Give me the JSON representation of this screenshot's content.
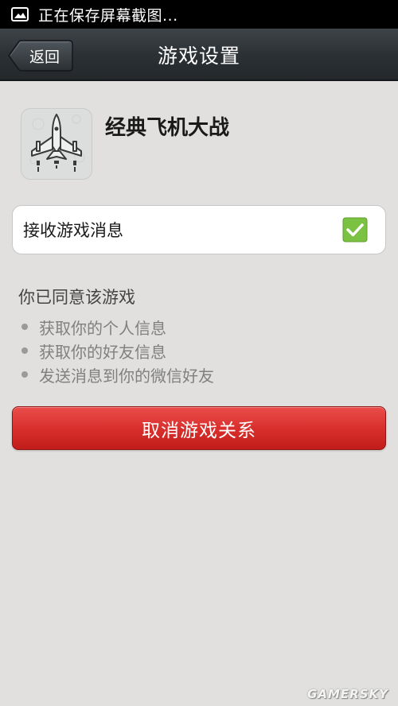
{
  "status_bar": {
    "text": "正在保存屏幕截图...",
    "icon": "screenshot-icon"
  },
  "nav": {
    "back_label": "返回",
    "title": "游戏设置"
  },
  "game": {
    "name": "经典飞机大战",
    "icon": "plane-game-icon"
  },
  "settings": {
    "receive_messages_label": "接收游戏消息",
    "receive_messages_checked": true
  },
  "permissions": {
    "title": "你已同意该游戏",
    "items": [
      "获取你的个人信息",
      "获取你的好友信息",
      "发送消息到你的微信好友"
    ]
  },
  "actions": {
    "cancel_label": "取消游戏关系"
  },
  "watermark": "GAMERSKY",
  "colors": {
    "background": "#e1e0de",
    "nav_bar": "#2c3135",
    "check_green": "#7cc242",
    "danger_red": "#d9302d"
  }
}
